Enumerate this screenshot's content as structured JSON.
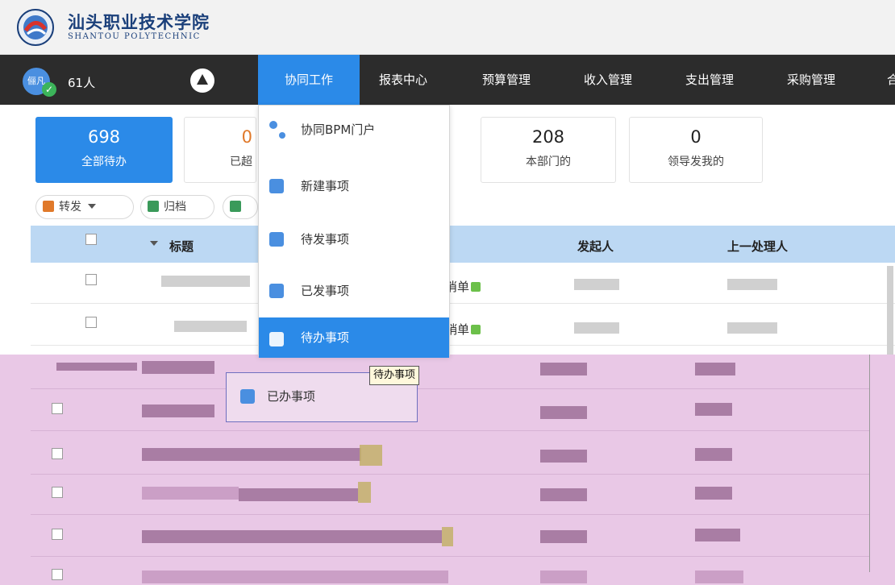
{
  "header": {
    "school_name_cn": "汕头职业技术学院",
    "school_name_en": "SHANTOU POLYTECHNIC"
  },
  "navbar": {
    "user_initials": "俪凡",
    "user_count": "61人",
    "items": [
      {
        "label": "协同工作",
        "active": true
      },
      {
        "label": "报表中心"
      },
      {
        "label": "预算管理"
      },
      {
        "label": "收入管理"
      },
      {
        "label": "支出管理"
      },
      {
        "label": "采购管理"
      },
      {
        "label": "合"
      }
    ]
  },
  "stat_cards": [
    {
      "value": "698",
      "label": "全部待办",
      "active": true
    },
    {
      "value": "0",
      "label": "已超"
    },
    {
      "value": "208",
      "label": "本部门的"
    },
    {
      "value": "0",
      "label": "领导发我的"
    }
  ],
  "toolbar": {
    "forward_label": "转发",
    "archive_label": "归档",
    "delete_partial": ""
  },
  "table": {
    "columns": [
      "标题",
      "发起人",
      "上一处理人"
    ],
    "rows": [
      {
        "title_suffix": "消单"
      },
      {
        "title_suffix": "销单"
      }
    ]
  },
  "dropdown": {
    "items": [
      {
        "label": "协同BPM门户",
        "icon": "bpm-icon"
      },
      {
        "label": "新建事项",
        "icon": "document-icon"
      },
      {
        "label": "待发事项",
        "icon": "document-icon"
      },
      {
        "label": "已发事项",
        "icon": "document-icon"
      },
      {
        "label": "待办事项",
        "icon": "document-icon",
        "selected": true
      }
    ],
    "ghost_item": "已办事项",
    "tooltip": "待办事项"
  },
  "colors": {
    "accent": "#2b8ae8",
    "navbar_bg": "#2c2c2c",
    "table_header_bg": "#bcd8f3",
    "overlay_pink": "#e9c8e6"
  }
}
